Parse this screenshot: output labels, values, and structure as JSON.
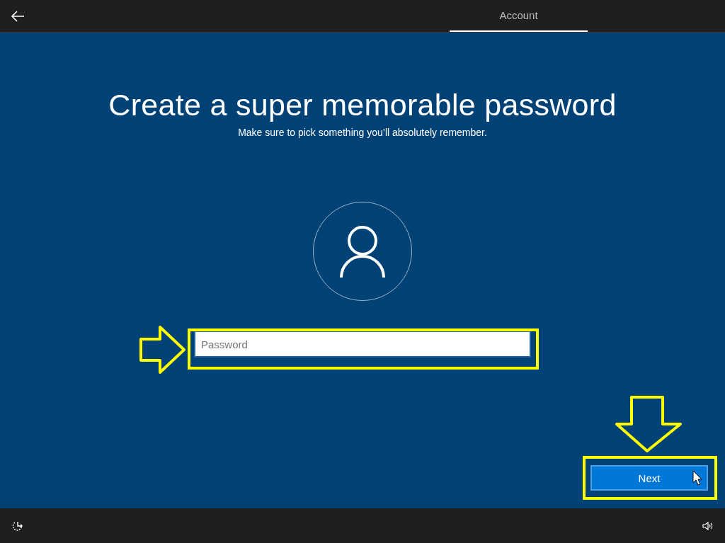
{
  "tabs": [
    {
      "label": "Account",
      "selected": true
    }
  ],
  "title": "Create a super memorable password",
  "subtitle": "Make sure to pick something you’ll absolutely remember.",
  "password_field": {
    "placeholder": "Password"
  },
  "buttons": [
    "Next"
  ]
}
